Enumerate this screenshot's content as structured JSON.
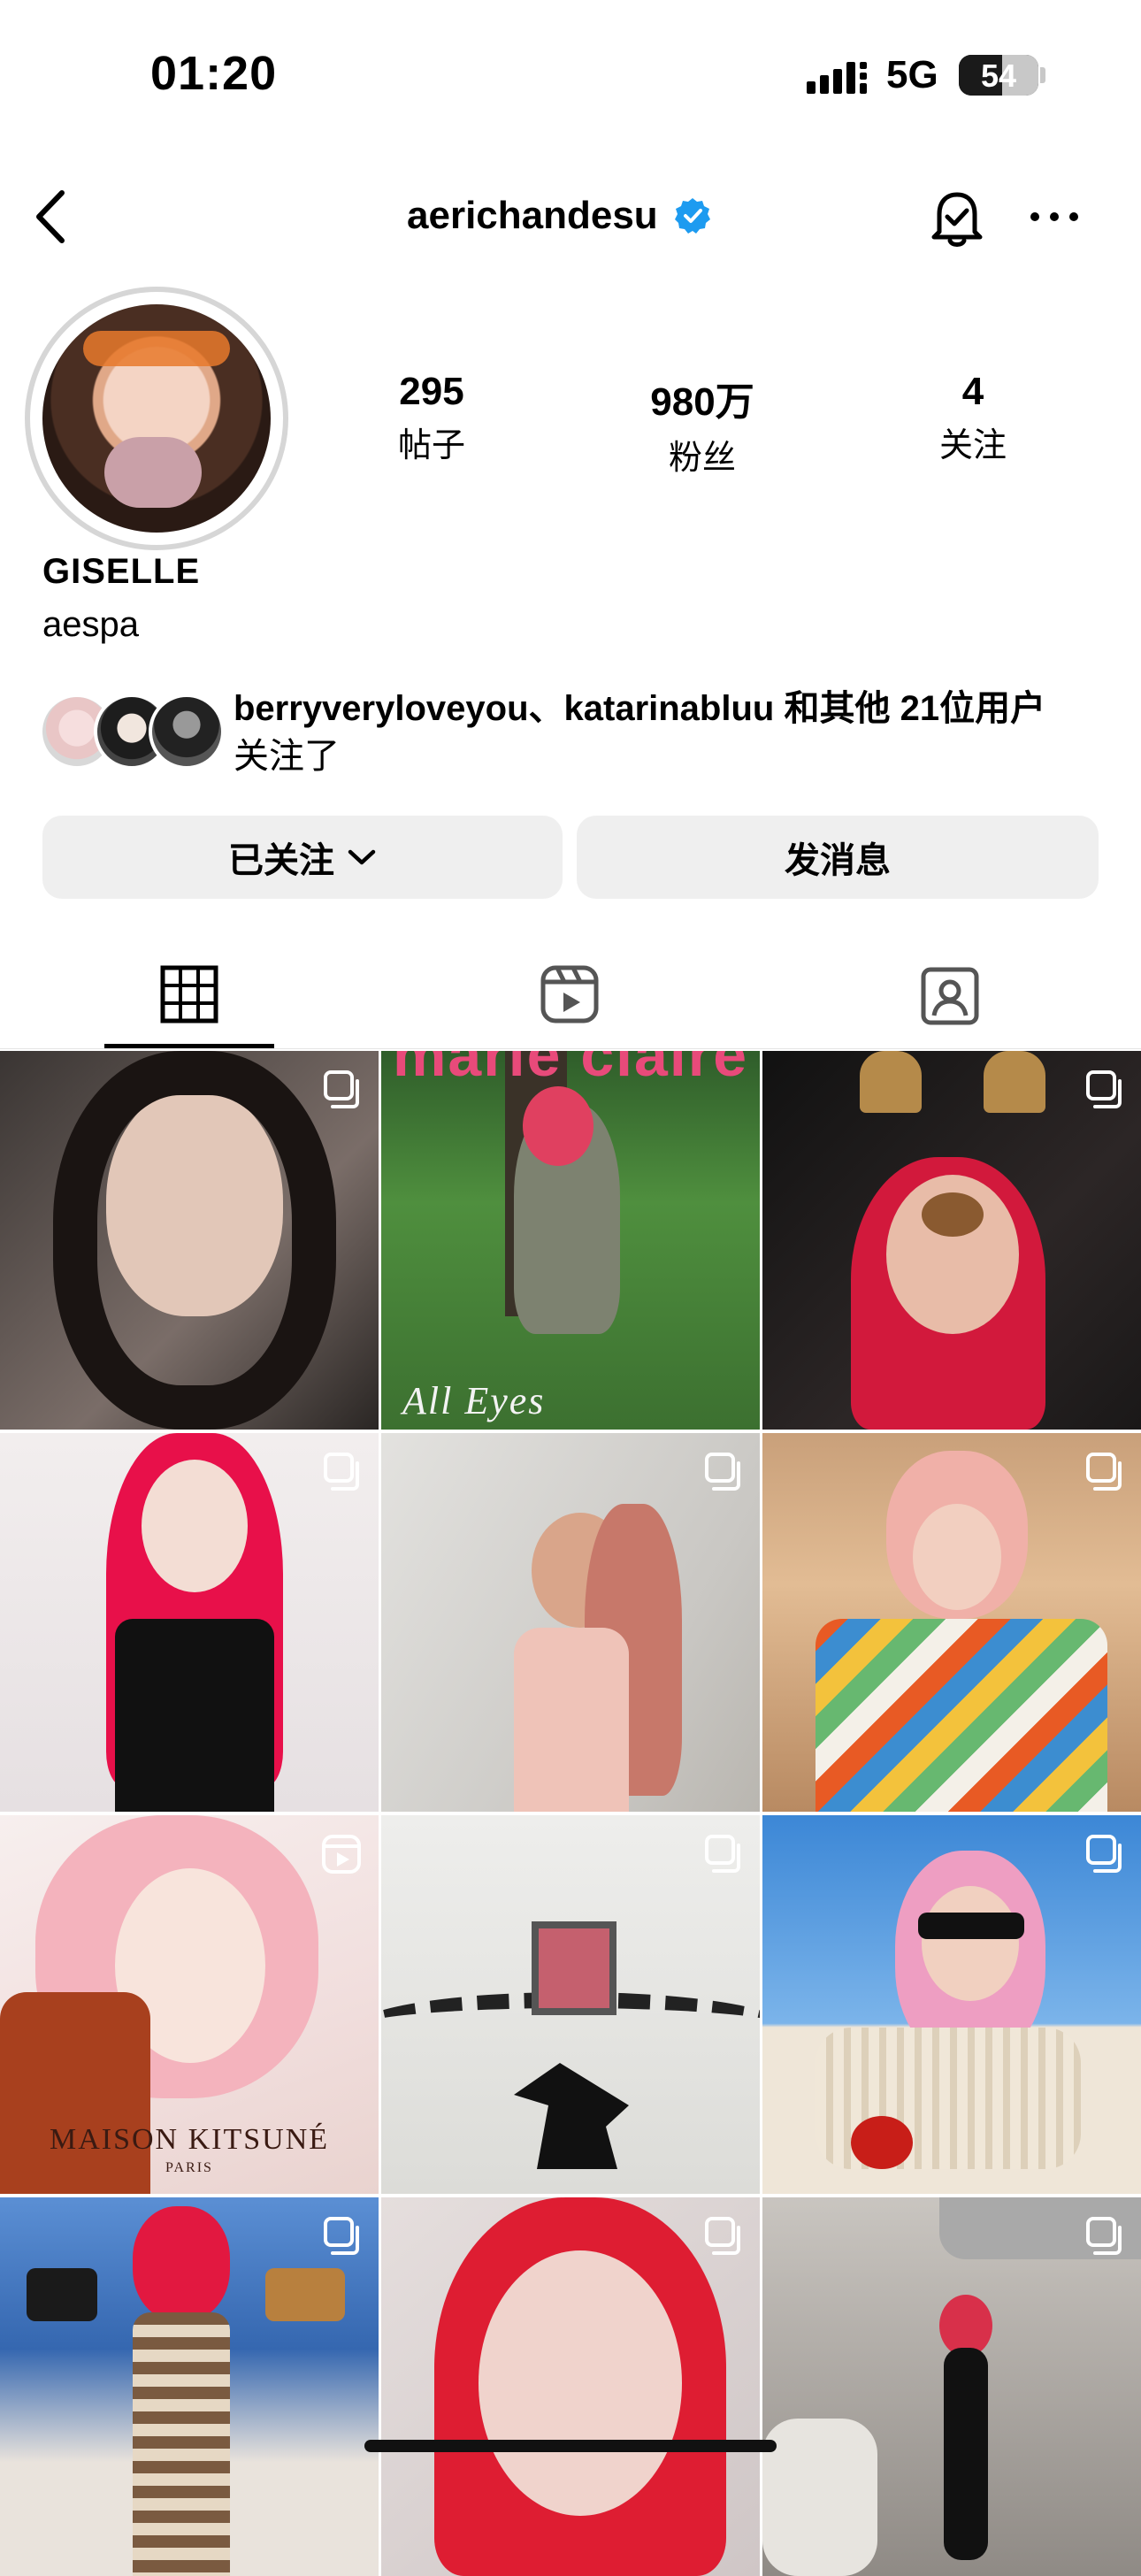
{
  "status_bar": {
    "time": "01:20",
    "network": "5G",
    "battery": "54",
    "battery_level": 0.54
  },
  "header": {
    "username": "aerichandesu"
  },
  "profile": {
    "stats": [
      {
        "value": "295",
        "label": "帖子"
      },
      {
        "value": "980万",
        "label": "粉丝"
      },
      {
        "value": "4",
        "label": "关注"
      }
    ],
    "display_name": "GISELLE",
    "bio": "aespa",
    "mutual": {
      "names": "berryveryloveyou、katarinabluu",
      "suffix": " 和其他 21位用户",
      "line2": "关注了"
    }
  },
  "buttons": {
    "following": "已关注",
    "message": "发消息"
  },
  "grid": [
    {
      "label": "post-1",
      "type": "carousel"
    },
    {
      "label": "post-2",
      "type": "none",
      "caption_top": "marie claire",
      "caption_bottom": "All Eyes"
    },
    {
      "label": "post-3",
      "type": "carousel"
    },
    {
      "label": "post-4",
      "type": "carousel"
    },
    {
      "label": "post-5",
      "type": "carousel"
    },
    {
      "label": "post-6",
      "type": "carousel"
    },
    {
      "label": "post-7",
      "type": "reel",
      "caption": "MAISON KITSUNÉ",
      "caption_sub": "PARIS"
    },
    {
      "label": "post-8",
      "type": "carousel"
    },
    {
      "label": "post-9",
      "type": "carousel"
    },
    {
      "label": "post-10",
      "type": "carousel"
    },
    {
      "label": "post-11",
      "type": "carousel"
    },
    {
      "label": "post-12",
      "type": "carousel"
    }
  ]
}
